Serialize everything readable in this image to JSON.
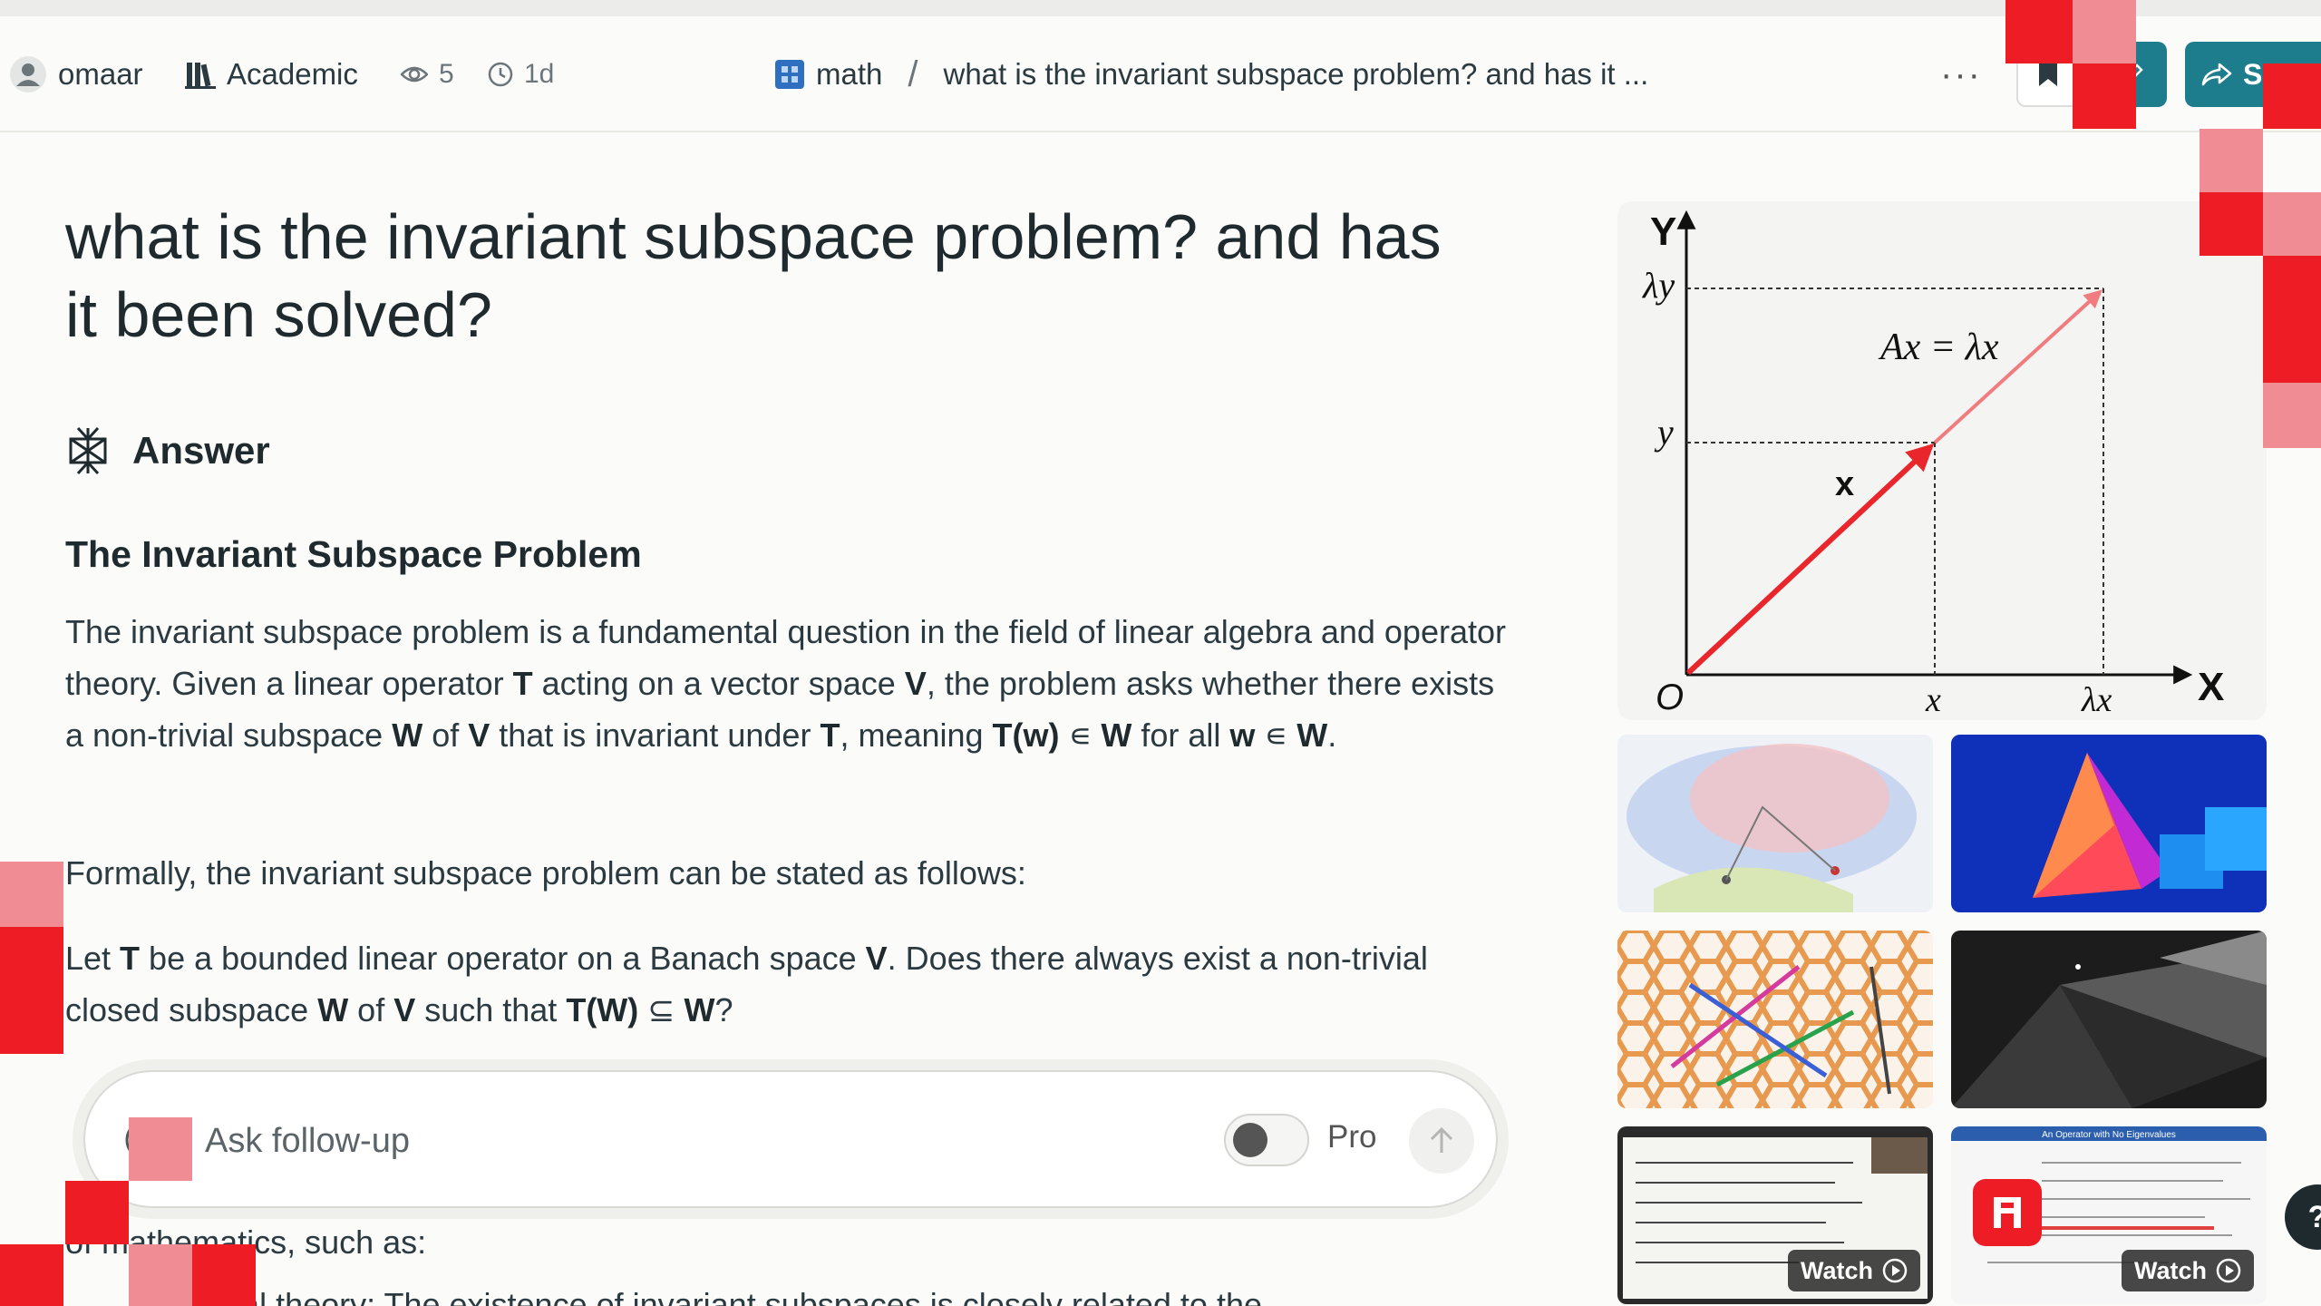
{
  "header": {
    "user": "omaar",
    "collection": "Academic",
    "views": "5",
    "age": "1d",
    "breadcrumb_space": "math",
    "breadcrumb_sep": "/",
    "breadcrumb_title": "what is the invariant subspace problem? and has it ...",
    "more": "···",
    "share_label": "S"
  },
  "main": {
    "title": "what is the invariant subspace problem? and has it been solved?",
    "answer_label": "Answer",
    "section_title": "The Invariant Subspace Problem",
    "p1": {
      "a": "The invariant subspace problem is a fundamental question in the field of linear algebra and operator theory. Given a linear operator ",
      "T": "T",
      "b": " acting on a vector space ",
      "V": "V",
      "c": ", the problem asks whether there exists a non-trivial subspace ",
      "W": "W",
      "d": " of ",
      "V2": "V",
      "e": " that is invariant under ",
      "T2": "T",
      "f": ", meaning ",
      "Tw": "T(w)",
      "g": " ∊ ",
      "W2": "W",
      "h": " for all ",
      "w": "w",
      "i": " ∊ ",
      "W3": "W",
      "j": "."
    },
    "p2": "Formally, the invariant subspace problem can be stated as follows:",
    "p3": {
      "a": "Let ",
      "T": "T",
      "b": " be a bounded linear operator on a Banach space ",
      "V": "V",
      "c": ". Does there always exist a non-trivial closed subspace ",
      "W": "W",
      "d": " of ",
      "V2": "V",
      "e": " such that ",
      "TW": "T(W)",
      "f": " ⊆ ",
      "W2": "W",
      "g": "?"
    },
    "p4": "of mathematics, such as:",
    "p5": "Spectral theory: The existence of invariant subspaces is closely related to the"
  },
  "followup": {
    "placeholder": "Ask follow-up",
    "pro_label": "Pro"
  },
  "diagram": {
    "axis_y": "Y",
    "axis_x": "X",
    "origin": "O",
    "label_ly": "λy",
    "label_y": "y",
    "label_x": "x",
    "label_lx": "λx",
    "vector_label": "x",
    "equation": "Ax = λx"
  },
  "thumbnails": {
    "watch_label": "Watch",
    "slide_header": "An Operator with No Eigenvalues"
  },
  "help": "?"
}
